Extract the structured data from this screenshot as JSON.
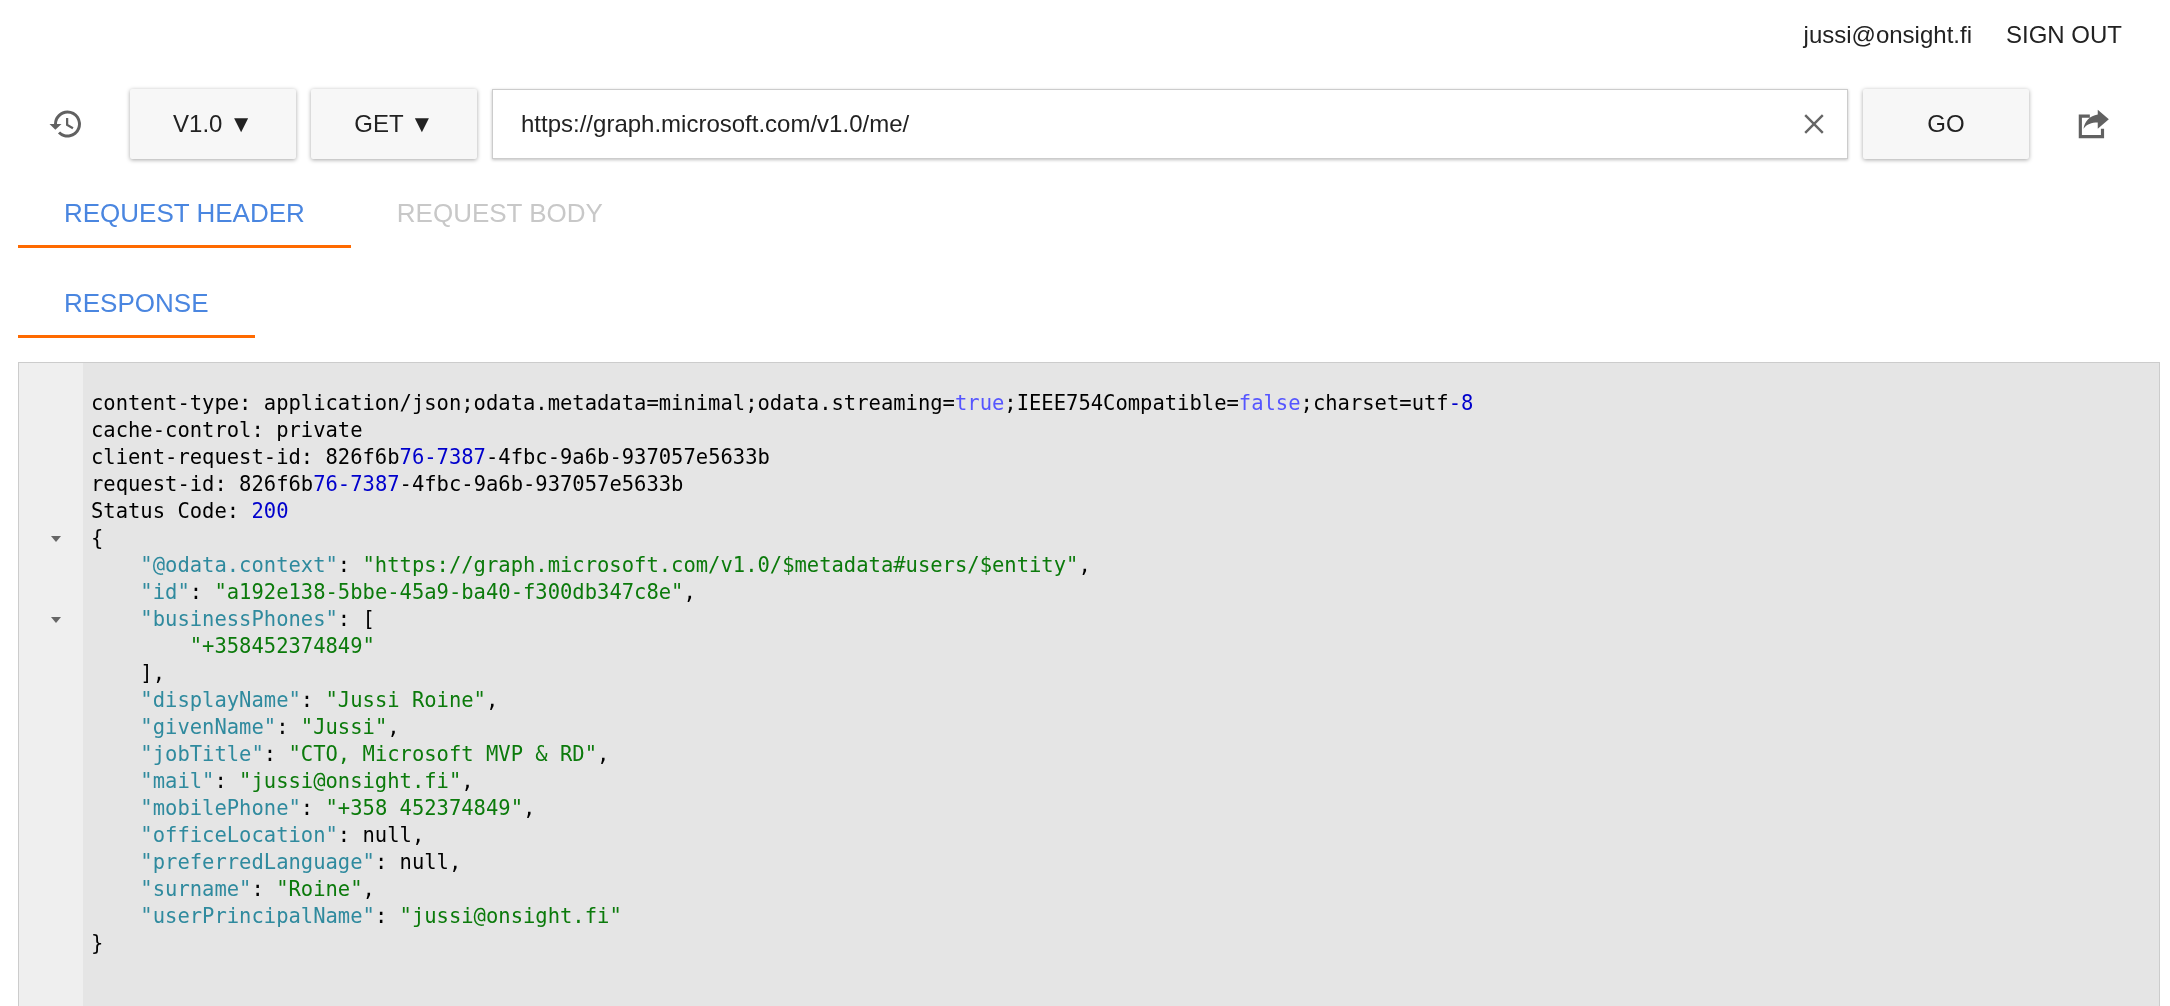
{
  "user": {
    "email": "jussi@onsight.fi",
    "sign_out": "SIGN OUT"
  },
  "toolbar": {
    "version": "V1.0 ▼",
    "method": "GET ▼",
    "url": "https://graph.microsoft.com/v1.0/me/",
    "go": "GO"
  },
  "tab_rows": [
    {
      "tabs": [
        {
          "label": "REQUEST HEADER",
          "selected": true,
          "disabled": false
        },
        {
          "label": "REQUEST BODY",
          "selected": false,
          "disabled": true
        }
      ]
    },
    {
      "tabs": [
        {
          "label": "RESPONSE",
          "selected": true,
          "disabled": false
        }
      ]
    }
  ],
  "response": {
    "lines": [
      {
        "foldable": false,
        "tokens": [
          {
            "kind": "plain",
            "text": "content-type: application/json;odata.metadata=minimal;odata.streaming="
          },
          {
            "kind": "literal",
            "text": "true"
          },
          {
            "kind": "plain",
            "text": ";IEEE754Compatible="
          },
          {
            "kind": "literal",
            "text": "false"
          },
          {
            "kind": "plain",
            "text": ";charset=utf"
          },
          {
            "kind": "number",
            "text": "-8"
          }
        ]
      },
      {
        "foldable": false,
        "tokens": [
          {
            "kind": "plain",
            "text": "cache-control: private"
          }
        ]
      },
      {
        "foldable": false,
        "tokens": [
          {
            "kind": "plain",
            "text": "client-request-id: 826f6b"
          },
          {
            "kind": "number",
            "text": "76-7387"
          },
          {
            "kind": "plain",
            "text": "-4fbc-9a6b-937057e5633b"
          }
        ]
      },
      {
        "foldable": false,
        "tokens": [
          {
            "kind": "plain",
            "text": "request-id: 826f6b"
          },
          {
            "kind": "number",
            "text": "76-7387"
          },
          {
            "kind": "plain",
            "text": "-4fbc-9a6b-937057e5633b"
          }
        ]
      },
      {
        "foldable": false,
        "tokens": [
          {
            "kind": "plain",
            "text": "Status Code: "
          },
          {
            "kind": "number",
            "text": "200"
          }
        ]
      },
      {
        "foldable": true,
        "tokens": [
          {
            "kind": "plain",
            "text": "{"
          }
        ]
      },
      {
        "foldable": false,
        "tokens": [
          {
            "kind": "key",
            "text": "    \"@odata.context\""
          },
          {
            "kind": "plain",
            "text": ": "
          },
          {
            "kind": "string",
            "text": "\"https://graph.microsoft.com/v1.0/$metadata#users/$entity\""
          },
          {
            "kind": "plain",
            "text": ","
          }
        ]
      },
      {
        "foldable": false,
        "tokens": [
          {
            "kind": "key",
            "text": "    \"id\""
          },
          {
            "kind": "plain",
            "text": ": "
          },
          {
            "kind": "string",
            "text": "\"a192e138-5bbe-45a9-ba40-f300db347c8e\""
          },
          {
            "kind": "plain",
            "text": ","
          }
        ]
      },
      {
        "foldable": true,
        "tokens": [
          {
            "kind": "key",
            "text": "    \"businessPhones\""
          },
          {
            "kind": "plain",
            "text": ": ["
          }
        ]
      },
      {
        "foldable": false,
        "tokens": [
          {
            "kind": "string",
            "text": "        \"+358452374849\""
          }
        ]
      },
      {
        "foldable": false,
        "tokens": [
          {
            "kind": "plain",
            "text": "    ],"
          }
        ]
      },
      {
        "foldable": false,
        "tokens": [
          {
            "kind": "key",
            "text": "    \"displayName\""
          },
          {
            "kind": "plain",
            "text": ": "
          },
          {
            "kind": "string",
            "text": "\"Jussi Roine\""
          },
          {
            "kind": "plain",
            "text": ","
          }
        ]
      },
      {
        "foldable": false,
        "tokens": [
          {
            "kind": "key",
            "text": "    \"givenName\""
          },
          {
            "kind": "plain",
            "text": ": "
          },
          {
            "kind": "string",
            "text": "\"Jussi\""
          },
          {
            "kind": "plain",
            "text": ","
          }
        ]
      },
      {
        "foldable": false,
        "tokens": [
          {
            "kind": "key",
            "text": "    \"jobTitle\""
          },
          {
            "kind": "plain",
            "text": ": "
          },
          {
            "kind": "string",
            "text": "\"CTO, Microsoft MVP & RD\""
          },
          {
            "kind": "plain",
            "text": ","
          }
        ]
      },
      {
        "foldable": false,
        "tokens": [
          {
            "kind": "key",
            "text": "    \"mail\""
          },
          {
            "kind": "plain",
            "text": ": "
          },
          {
            "kind": "string",
            "text": "\"jussi@onsight.fi\""
          },
          {
            "kind": "plain",
            "text": ","
          }
        ]
      },
      {
        "foldable": false,
        "tokens": [
          {
            "kind": "key",
            "text": "    \"mobilePhone\""
          },
          {
            "kind": "plain",
            "text": ": "
          },
          {
            "kind": "string",
            "text": "\"+358 452374849\""
          },
          {
            "kind": "plain",
            "text": ","
          }
        ]
      },
      {
        "foldable": false,
        "tokens": [
          {
            "kind": "key",
            "text": "    \"officeLocation\""
          },
          {
            "kind": "plain",
            "text": ": null,"
          }
        ]
      },
      {
        "foldable": false,
        "tokens": [
          {
            "kind": "key",
            "text": "    \"preferredLanguage\""
          },
          {
            "kind": "plain",
            "text": ": null,"
          }
        ]
      },
      {
        "foldable": false,
        "tokens": [
          {
            "kind": "key",
            "text": "    \"surname\""
          },
          {
            "kind": "plain",
            "text": ": "
          },
          {
            "kind": "string",
            "text": "\"Roine\""
          },
          {
            "kind": "plain",
            "text": ","
          }
        ]
      },
      {
        "foldable": false,
        "tokens": [
          {
            "kind": "key",
            "text": "    \"userPrincipalName\""
          },
          {
            "kind": "plain",
            "text": ": "
          },
          {
            "kind": "string",
            "text": "\"jussi@onsight.fi\""
          }
        ]
      },
      {
        "foldable": false,
        "tokens": [
          {
            "kind": "plain",
            "text": "}"
          }
        ]
      }
    ]
  }
}
